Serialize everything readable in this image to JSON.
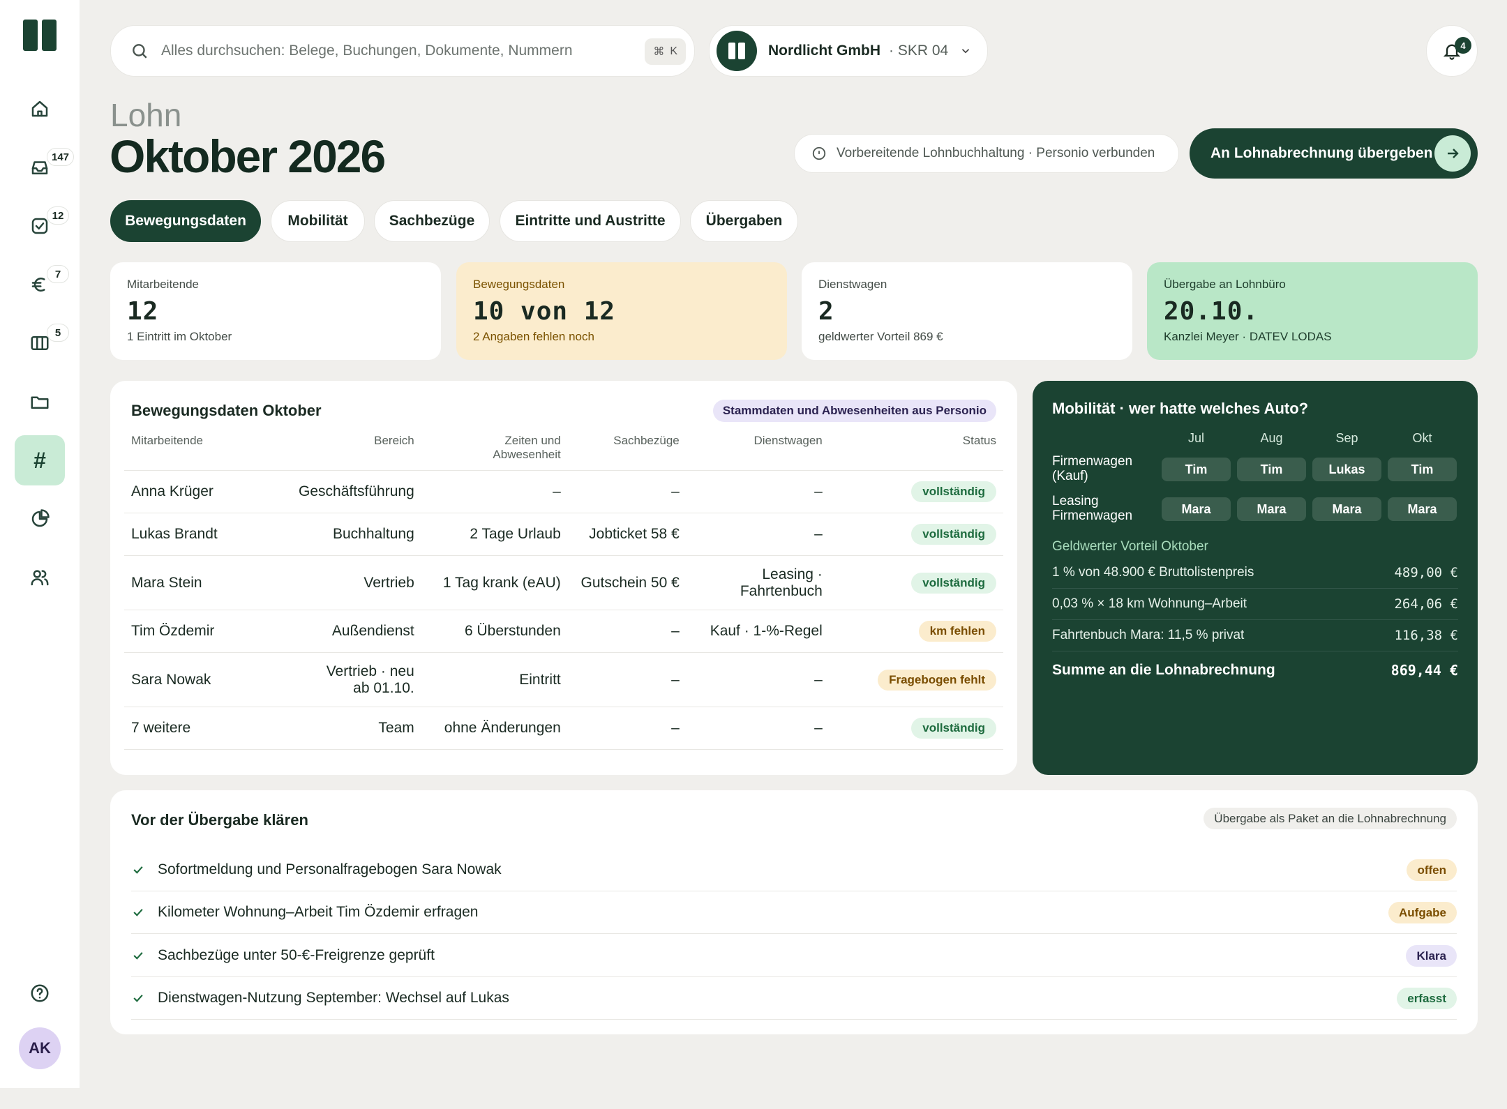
{
  "sidebar": {
    "badges": {
      "inbox": "147",
      "tasks": "12",
      "finance": "7",
      "columns": "5"
    },
    "avatar": "AK"
  },
  "search": {
    "placeholder": "Alles durchsuchen: Belege, Buchungen, Dokumente, Nummern",
    "shortcut_symbol": "⌘",
    "shortcut_key": "K"
  },
  "company": {
    "name": "Nordlicht GmbH",
    "chart": "· SKR 04"
  },
  "notifications": {
    "count": "4"
  },
  "page": {
    "breadcrumb": "Lohn",
    "title": "Oktober 2026"
  },
  "info": {
    "text": "Vorbereitende Lohnbuchhaltung · Personio verbunden"
  },
  "handover_button": {
    "label": "An Lohnabrechnung übergeben"
  },
  "tabs": [
    "Bewegungsdaten",
    "Mobilität",
    "Sachbezüge",
    "Eintritte und Austritte",
    "Übergaben"
  ],
  "cards": [
    {
      "label": "Mitarbeitende",
      "value": "12",
      "sub": "1 Eintritt im Oktober"
    },
    {
      "label": "Bewegungsdaten",
      "value": "10 von 12",
      "sub": "2 Angaben fehlen noch"
    },
    {
      "label": "Dienstwagen",
      "value": "2",
      "sub": "geldwerter Vorteil 869 €"
    },
    {
      "label": "Übergabe an Lohnbüro",
      "value": "20.10.",
      "sub": "Kanzlei Meyer · DATEV LODAS"
    }
  ],
  "movement": {
    "title": "Bewegungsdaten Oktober",
    "source_tag": "Stammdaten und Abwesenheiten aus Personio",
    "columns": [
      "Mitarbeitende",
      "Bereich",
      "Zeiten und Abwesenheit",
      "Sachbezüge",
      "Dienstwagen",
      "Status"
    ],
    "rows": [
      [
        "Anna Krüger",
        "Geschäftsführung",
        "–",
        "–",
        "–",
        "vollständig"
      ],
      [
        "Lukas Brandt",
        "Buchhaltung",
        "2 Tage Urlaub",
        "Jobticket 58 €",
        "–",
        "vollständig"
      ],
      [
        "Mara Stein",
        "Vertrieb",
        "1 Tag krank (eAU)",
        "Gutschein 50 €",
        "Leasing · Fahrtenbuch",
        "vollständig"
      ],
      [
        "Tim Özdemir",
        "Außendienst",
        "6 Überstunden",
        "–",
        "Kauf · 1-%-Regel",
        "km fehlen"
      ],
      [
        "Sara Nowak",
        "Vertrieb · neu ab 01.10.",
        "Eintritt",
        "–",
        "–",
        "Fragebogen fehlt"
      ],
      [
        "7 weitere",
        "Team",
        "ohne Änderungen",
        "–",
        "–",
        "vollständig"
      ]
    ]
  },
  "mobility": {
    "title": "Mobilität · wer hatte welches Auto?",
    "months": [
      "Jul",
      "Aug",
      "Sep",
      "Okt"
    ],
    "cars": [
      {
        "label": "Firmenwagen (Kauf)",
        "drivers": [
          "Tim",
          "Tim",
          "Lukas",
          "Tim"
        ]
      },
      {
        "label": "Leasing Firmenwagen",
        "drivers": [
          "Mara",
          "Mara",
          "Mara",
          "Mara"
        ]
      }
    ],
    "benefit_title": "Geldwerter Vorteil Oktober",
    "benefits": [
      {
        "label": "1 % von 48.900 € Bruttolistenpreis",
        "amount": "489,00 €"
      },
      {
        "label": "0,03 % × 18 km Wohnung–Arbeit",
        "amount": "264,06 €"
      },
      {
        "label": "Fahrtenbuch Mara: 11,5 % privat",
        "amount": "116,38 €"
      }
    ],
    "sum_label": "Summe an die Lohnabrechnung",
    "sum_amount": "869,44 €"
  },
  "clarify": {
    "title": "Vor der Übergabe klären",
    "package_tag": "Übergabe als Paket an die Lohnabrechnung",
    "items": [
      {
        "text": "Sofortmeldung und Personalfragebogen Sara Nowak",
        "tag": "offen"
      },
      {
        "text": "Kilometer Wohnung–Arbeit Tim Özdemir erfragen",
        "tag": "Aufgabe"
      },
      {
        "text": "Sachbezüge unter 50-€-Freigrenze geprüft",
        "tag": "Klara"
      },
      {
        "text": "Dienstwagen-Nutzung September: Wechsel auf Lukas",
        "tag": "erfasst"
      }
    ]
  },
  "colors": {
    "brand": "#1b4332",
    "accent_light": "#c9ebd6",
    "warn_bg": "#fbeccd",
    "ok_bg": "#b9e7c7"
  }
}
